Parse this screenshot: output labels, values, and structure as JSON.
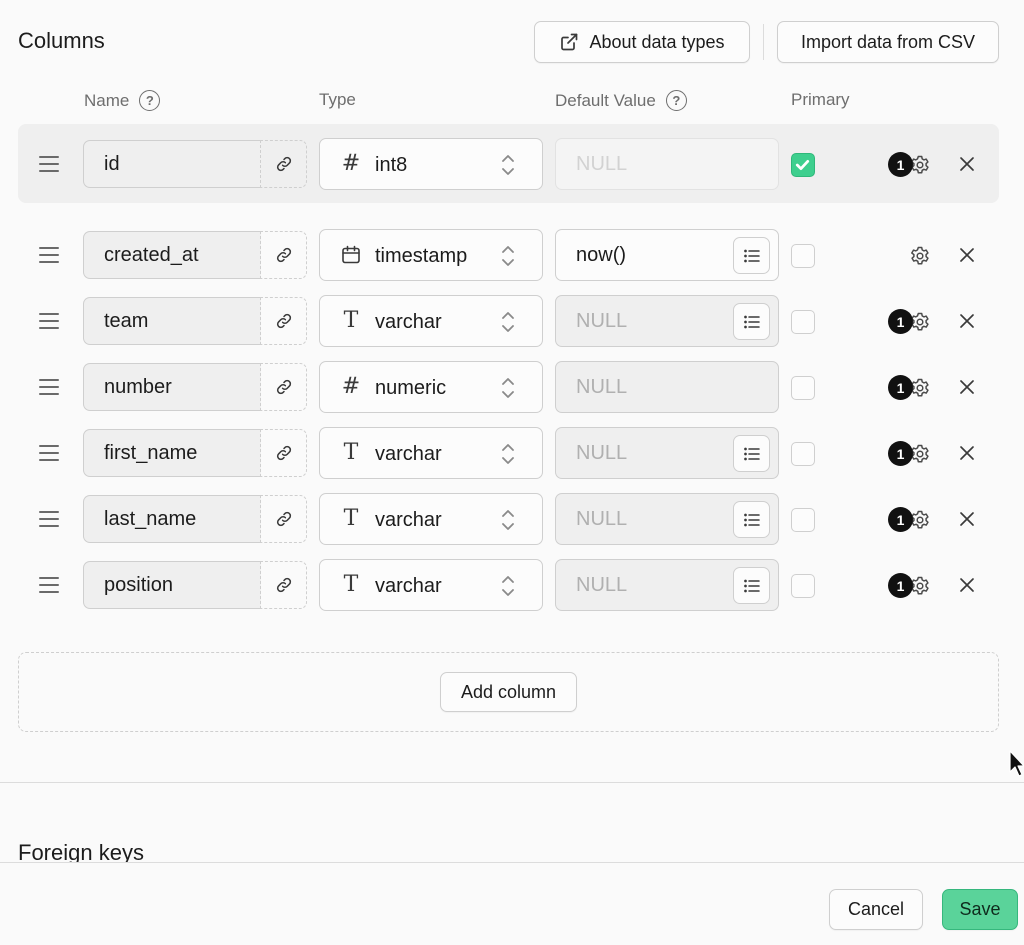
{
  "header": {
    "title": "Columns",
    "about_label": "About data types",
    "import_label": "Import data from CSV"
  },
  "column_headers": {
    "name": "Name",
    "type": "Type",
    "default_value": "Default Value",
    "primary": "Primary"
  },
  "rows": [
    {
      "name": "id",
      "type_icon": "#",
      "type": "int8",
      "default": "NULL"
    },
    {
      "name": "created_at",
      "type_icon": "calendar",
      "type": "timestamp",
      "default": "now()"
    },
    {
      "name": "team",
      "type_icon": "T",
      "type": "varchar",
      "default": "NULL"
    },
    {
      "name": "number",
      "type_icon": "#",
      "type": "numeric",
      "default": "NULL"
    },
    {
      "name": "first_name",
      "type_icon": "T",
      "type": "varchar",
      "default": "NULL"
    },
    {
      "name": "last_name",
      "type_icon": "T",
      "type": "varchar",
      "default": "NULL"
    },
    {
      "name": "position",
      "type_icon": "T",
      "type": "varchar",
      "default": "NULL"
    }
  ],
  "badge_count": "1",
  "add_column_label": "Add column",
  "foreign_keys_title": "Foreign keys",
  "footer": {
    "cancel_label": "Cancel",
    "save_label": "Save"
  },
  "colors": {
    "accent": "#3ecf8e",
    "save_bg": "#5ad39a"
  }
}
